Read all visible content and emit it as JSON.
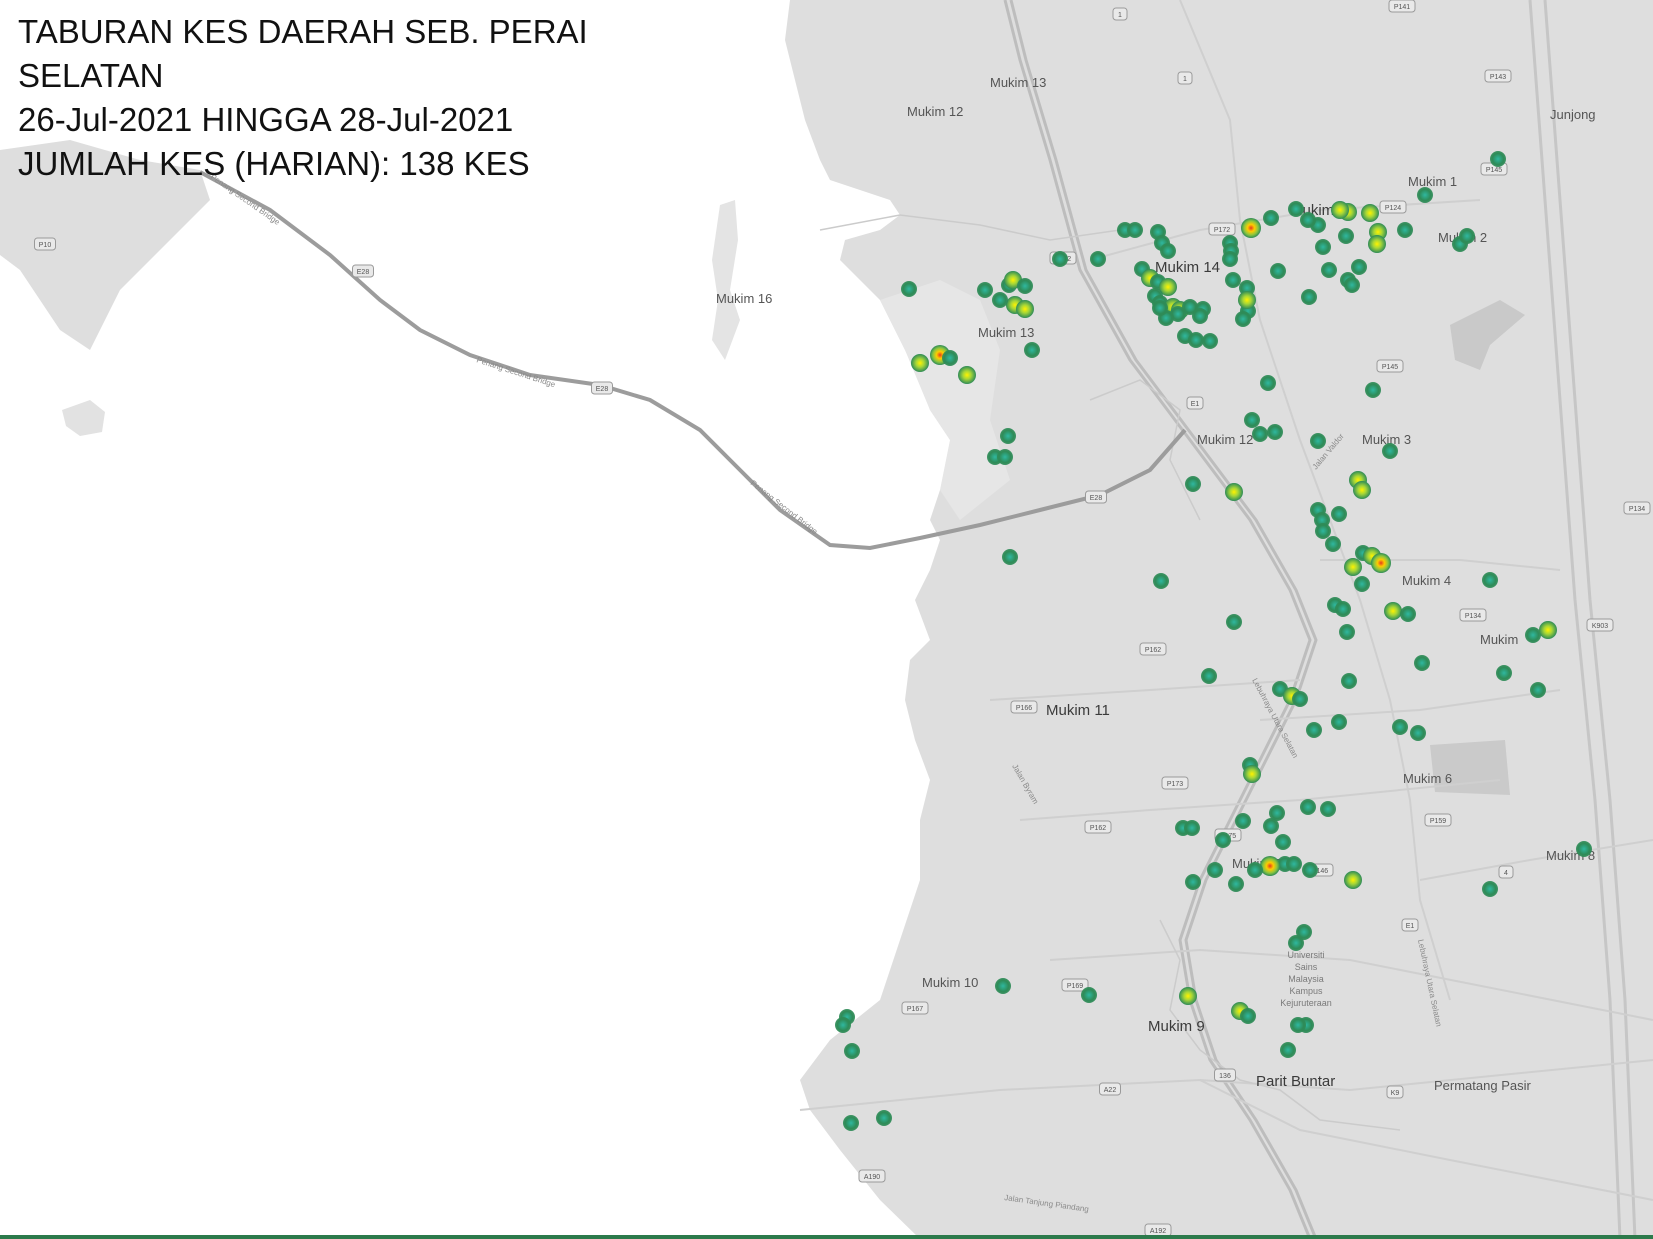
{
  "title": {
    "line1": "TABURAN KES DAERAH SEB. PERAI",
    "line2": "SELATAN",
    "line3": "26-Jul-2021 HINGGA 28-Jul-2021",
    "line4": "JUMLAH KES (HARIAN): 138 KES"
  },
  "colors": {
    "land": "#dedede",
    "water": "#ffffff",
    "road": "#c2c2c2",
    "bridge": "#9a9a9a",
    "heat_low": "#2e8b57",
    "heat_mid": "#7cc63c",
    "heat_high": "#ffe500",
    "heat_peak": "#e53b1f"
  },
  "map_labels": {
    "mukim1": "Mukim 1",
    "mukim2": "Mukim 2",
    "mukim3": "Mukim 3",
    "mukim4": "Mukim 4",
    "mukim5": "Mukim",
    "mukim6": "Mukim 6",
    "mukim7": "Mukim 7",
    "mukim8": "Mukim 8",
    "mukim9": "Mukim 9",
    "mukim10": "Mukim 10",
    "mukim11": "Mukim 11",
    "mukim12a": "Mukim 12",
    "mukim12b": "Mukim 12",
    "mukim13a": "Mukim 13",
    "mukim13b": "Mukim 13",
    "mukim14": "Mukim 14",
    "mukim15": "Mukim 15",
    "mukim16": "Mukim 16",
    "junjong": "Junjong",
    "parit_buntar": "Parit Buntar",
    "permatang_pasir": "Permatang Pasir",
    "bridge1": "Penang Second Bridge",
    "bridge2": "Penang Second Bridge",
    "bridge3": "Penang Second Bridge",
    "lebuhraya1": "Lebuhraya Utara Selatan",
    "lebuhraya2": "Lebuhraya Utara Selatan",
    "jalan_valdor": "Jalan Valdor",
    "jalan_byram": "Jalan Byram",
    "jalan_tanjung": "Jalan Tanjung Piandang",
    "usm1": "Universiti",
    "usm2": "Sains",
    "usm3": "Malaysia",
    "usm4": "Kampus",
    "usm5": "Kejuruteraan"
  },
  "road_shields": [
    "1",
    "1",
    "E1",
    "E1",
    "E28",
    "E28",
    "E28",
    "P10",
    "P172",
    "P172",
    "P124",
    "P145",
    "P145",
    "P143",
    "P141",
    "P134",
    "P162",
    "P162",
    "P166",
    "P173",
    "P175",
    "P146",
    "P159",
    "P169",
    "P167",
    "A22",
    "A190",
    "A192",
    "K9",
    "136",
    "4",
    "K903",
    "P134"
  ],
  "heatmap_points": [
    {
      "lon": 100.452,
      "lat": 5.386,
      "w": 1
    },
    {
      "lon": 100.452,
      "lat": 5.386,
      "w": 3
    }
  ]
}
